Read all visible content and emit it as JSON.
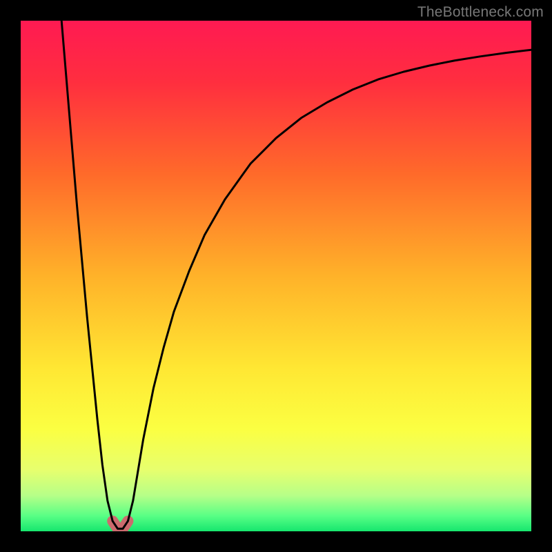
{
  "watermark": "TheBottleneck.com",
  "chart_data": {
    "type": "line",
    "title": "",
    "xlabel": "",
    "ylabel": "",
    "xlim": [
      0,
      100
    ],
    "ylim": [
      0,
      100
    ],
    "gradient_stops": [
      {
        "offset": 0.0,
        "color": "#ff1a52"
      },
      {
        "offset": 0.12,
        "color": "#ff2e3f"
      },
      {
        "offset": 0.3,
        "color": "#ff6a2a"
      },
      {
        "offset": 0.5,
        "color": "#ffb229"
      },
      {
        "offset": 0.68,
        "color": "#ffe733"
      },
      {
        "offset": 0.8,
        "color": "#fbff42"
      },
      {
        "offset": 0.88,
        "color": "#e7ff6e"
      },
      {
        "offset": 0.93,
        "color": "#b6ff88"
      },
      {
        "offset": 0.97,
        "color": "#58ff85"
      },
      {
        "offset": 1.0,
        "color": "#16e66e"
      }
    ],
    "series": [
      {
        "name": "bottleneck-curve",
        "x": [
          8,
          9,
          10,
          11,
          12,
          13,
          14,
          15,
          16,
          17,
          18,
          19,
          20,
          21,
          22,
          23,
          24,
          26,
          28,
          30,
          33,
          36,
          40,
          45,
          50,
          55,
          60,
          65,
          70,
          75,
          80,
          85,
          90,
          95,
          100
        ],
        "y": [
          100,
          88,
          76,
          64,
          53,
          42,
          32,
          22,
          13,
          6,
          2,
          0.5,
          0.5,
          2,
          6,
          12,
          18,
          28,
          36,
          43,
          51,
          58,
          65,
          72,
          77,
          81,
          84,
          86.5,
          88.5,
          90,
          91.2,
          92.2,
          93,
          93.7,
          94.3
        ]
      }
    ],
    "highlight_region": {
      "x_start": 18,
      "x_end": 21,
      "color": "#cc6a6e",
      "thickness": 16
    },
    "notes": "V-shaped bottleneck curve over a heat gradient; minimum near x≈19.5. Values estimated from pixels."
  }
}
